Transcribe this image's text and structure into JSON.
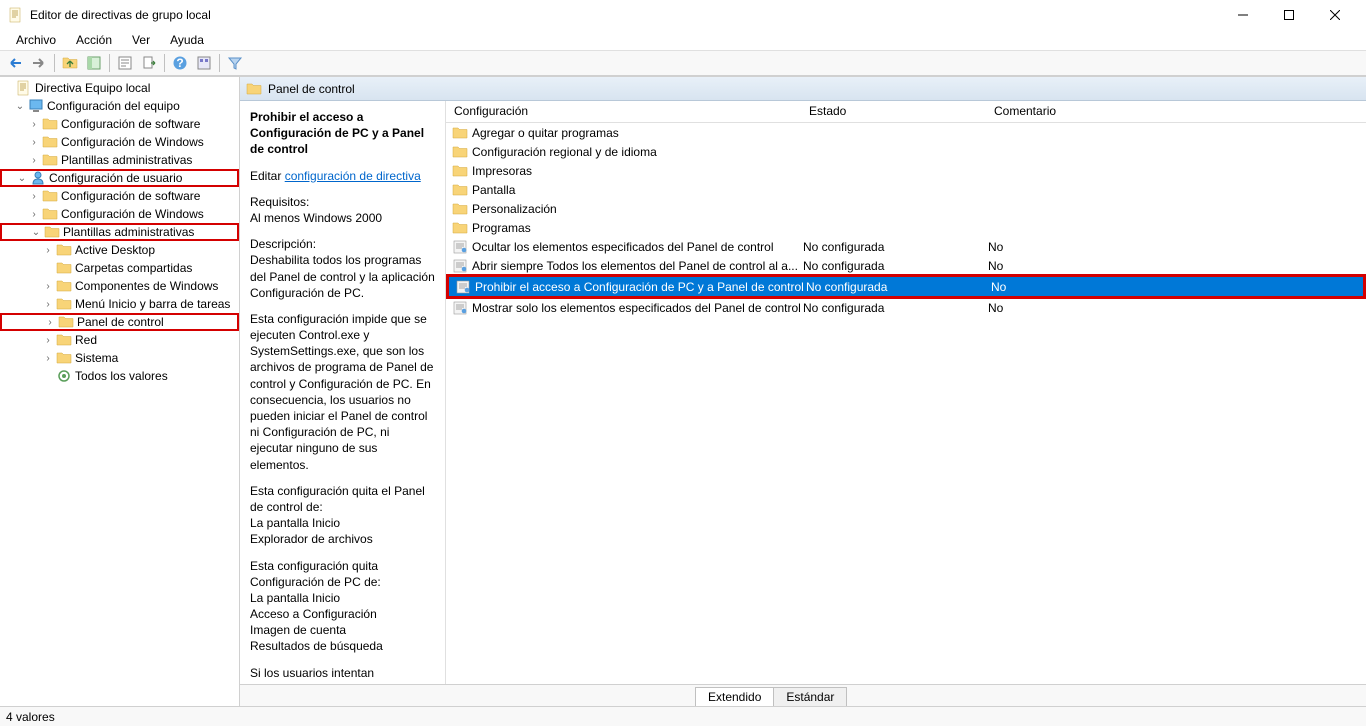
{
  "window": {
    "title": "Editor de directivas de grupo local"
  },
  "menu": {
    "items": [
      "Archivo",
      "Acción",
      "Ver",
      "Ayuda"
    ]
  },
  "tree": [
    {
      "indent": 0,
      "exp": "",
      "icon": "doc",
      "label": "Directiva Equipo local"
    },
    {
      "indent": 1,
      "exp": "v",
      "icon": "comp",
      "label": "Configuración del equipo"
    },
    {
      "indent": 2,
      "exp": ">",
      "icon": "folder",
      "label": "Configuración de software"
    },
    {
      "indent": 2,
      "exp": ">",
      "icon": "folder",
      "label": "Configuración de Windows"
    },
    {
      "indent": 2,
      "exp": ">",
      "icon": "folder",
      "label": "Plantillas administrativas"
    },
    {
      "indent": 1,
      "exp": "v",
      "icon": "user",
      "label": "Configuración de usuario",
      "box": true
    },
    {
      "indent": 2,
      "exp": ">",
      "icon": "folder",
      "label": "Configuración de software"
    },
    {
      "indent": 2,
      "exp": ">",
      "icon": "folder",
      "label": "Configuración de Windows"
    },
    {
      "indent": 2,
      "exp": "v",
      "icon": "folder",
      "label": "Plantillas administrativas",
      "box": true
    },
    {
      "indent": 3,
      "exp": ">",
      "icon": "folder",
      "label": "Active Desktop"
    },
    {
      "indent": 3,
      "exp": "",
      "icon": "folder",
      "label": "Carpetas compartidas"
    },
    {
      "indent": 3,
      "exp": ">",
      "icon": "folder",
      "label": "Componentes de Windows"
    },
    {
      "indent": 3,
      "exp": ">",
      "icon": "folder",
      "label": "Menú Inicio y barra de tareas"
    },
    {
      "indent": 3,
      "exp": ">",
      "icon": "folder",
      "label": "Panel de control",
      "box": true
    },
    {
      "indent": 3,
      "exp": ">",
      "icon": "folder",
      "label": "Red"
    },
    {
      "indent": 3,
      "exp": ">",
      "icon": "folder",
      "label": "Sistema"
    },
    {
      "indent": 3,
      "exp": "",
      "icon": "settings",
      "label": "Todos los valores"
    }
  ],
  "path_header": "Panel de control",
  "details": {
    "title": "Prohibir el acceso a Configuración de PC y a Panel de control",
    "edit_prefix": "Editar ",
    "edit_link": "configuración de directiva",
    "req_label": "Requisitos:",
    "req_value": "Al menos Windows 2000",
    "desc_label": "Descripción:",
    "desc_p1": "Deshabilita todos los programas del Panel de control y la aplicación Configuración de PC.",
    "desc_p2": "Esta configuración impide que se ejecuten Control.exe y SystemSettings.exe, que son los archivos de programa de Panel de control y Configuración de PC. En consecuencia, los usuarios no pueden iniciar el Panel de control ni Configuración de PC, ni ejecutar ninguno de sus elementos.",
    "desc_p3": "Esta configuración quita el Panel de control de:",
    "desc_p3a": "La pantalla Inicio",
    "desc_p3b": "Explorador de archivos",
    "desc_p4": "Esta configuración quita Configuración de PC de:",
    "desc_p4a": "La pantalla Inicio",
    "desc_p4b": "Acceso a Configuración",
    "desc_p4c": "Imagen de cuenta",
    "desc_p4d": "Resultados de búsqueda",
    "desc_p5": "Si los usuarios intentan seleccionar un elemento del Panel"
  },
  "list": {
    "headers": {
      "conf": "Configuración",
      "est": "Estado",
      "com": "Comentario"
    },
    "rows": [
      {
        "icon": "folder",
        "name": "Agregar o quitar programas",
        "est": "",
        "com": ""
      },
      {
        "icon": "folder",
        "name": "Configuración regional y de idioma",
        "est": "",
        "com": ""
      },
      {
        "icon": "folder",
        "name": "Impresoras",
        "est": "",
        "com": ""
      },
      {
        "icon": "folder",
        "name": "Pantalla",
        "est": "",
        "com": ""
      },
      {
        "icon": "folder",
        "name": "Personalización",
        "est": "",
        "com": ""
      },
      {
        "icon": "folder",
        "name": "Programas",
        "est": "",
        "com": ""
      },
      {
        "icon": "policy",
        "name": "Ocultar los elementos especificados del Panel de control",
        "est": "No configurada",
        "com": "No"
      },
      {
        "icon": "policy",
        "name": "Abrir siempre Todos los elementos del Panel de control al a...",
        "est": "No configurada",
        "com": "No"
      },
      {
        "icon": "policy",
        "name": "Prohibir el acceso a Configuración de PC y a Panel de control",
        "est": "No configurada",
        "com": "No",
        "sel": true,
        "boxrow": true
      },
      {
        "icon": "policy",
        "name": "Mostrar solo los elementos especificados del Panel de control",
        "est": "No configurada",
        "com": "No"
      }
    ]
  },
  "tabs": {
    "ext": "Extendido",
    "std": "Estándar"
  },
  "status": "4 valores"
}
